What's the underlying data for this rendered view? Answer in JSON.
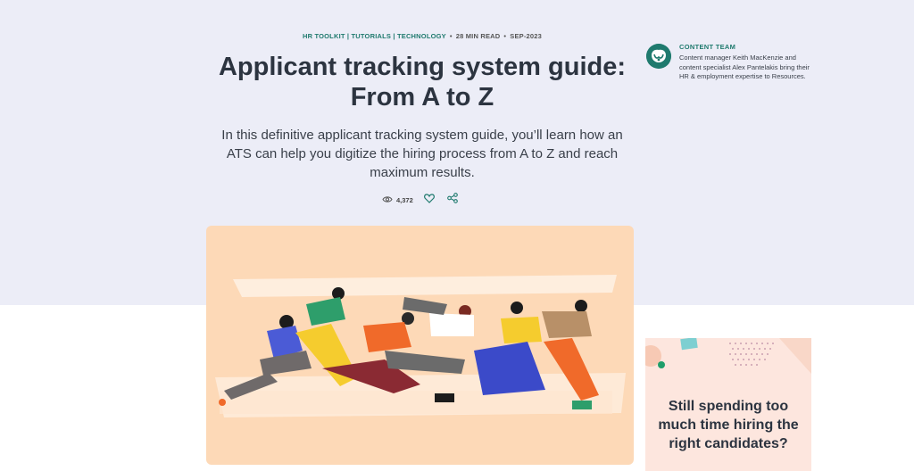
{
  "meta": {
    "categories": "HR TOOLKIT | TUTORIALS | TECHNOLOGY",
    "read_time": "28 MIN READ",
    "date": "SEP-2023"
  },
  "article": {
    "title_line1": "Applicant tracking system guide:",
    "title_line2": "From A to Z",
    "subtitle": "In this definitive applicant tracking system guide, you’ll learn how an ATS can help you digitize the hiring process from A to Z and reach maximum results."
  },
  "actions": {
    "views": "4,372",
    "view_icon": "eye-icon",
    "like_icon": "heart-icon",
    "share_icon": "share-icon"
  },
  "author": {
    "label": "CONTENT TEAM",
    "bio": "Content manager Keith MacKenzie and content specialist Alex Pantelakis bring their HR & employment expertise to Resources."
  },
  "promo": {
    "text": "Still spending too much time hiring the right candidates?"
  },
  "colors": {
    "accent": "#1f7a6e",
    "hero_bg": "#ecedf7",
    "image_bg": "#fdd9b7",
    "promo_bg": "#fde6de",
    "title": "#2c3440"
  }
}
